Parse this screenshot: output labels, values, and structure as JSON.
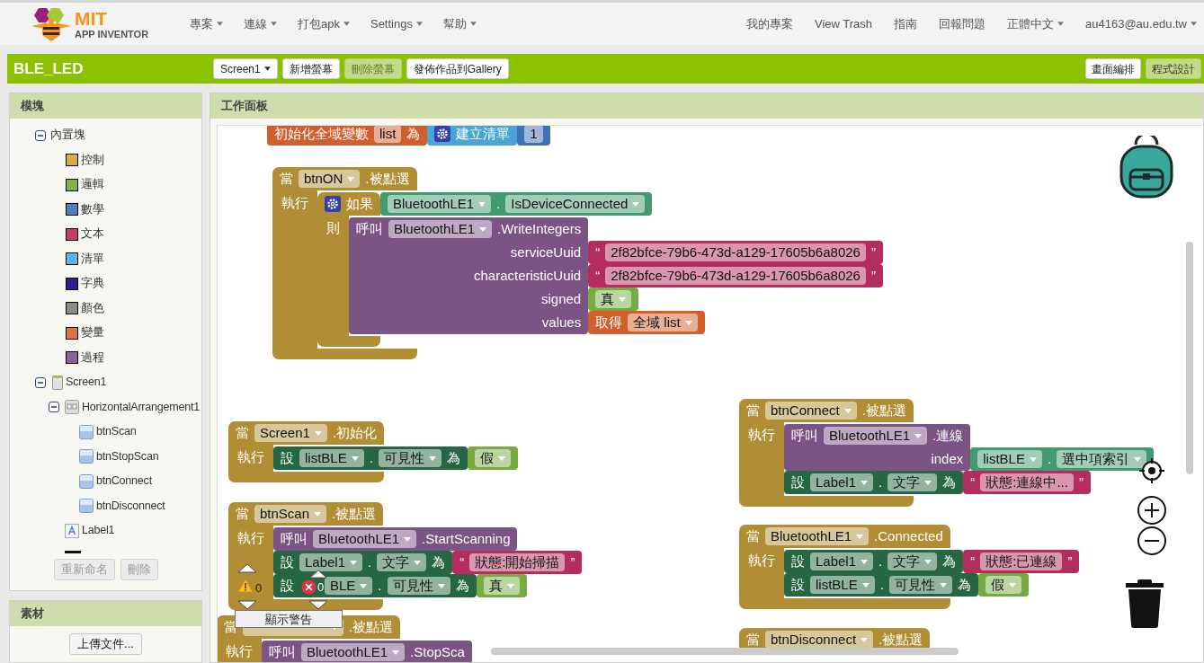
{
  "logo": {
    "title": "MIT",
    "subtitle": "APP INVENTOR"
  },
  "menus": [
    {
      "label": "專案",
      "dropdown": true
    },
    {
      "label": "連線",
      "dropdown": true
    },
    {
      "label": "打包apk",
      "dropdown": true
    },
    {
      "label": "Settings",
      "dropdown": true
    },
    {
      "label": "幫助",
      "dropdown": true
    }
  ],
  "right_menus": [
    {
      "label": "我的專案",
      "dropdown": false
    },
    {
      "label": "View Trash",
      "dropdown": false
    },
    {
      "label": "指南",
      "dropdown": false
    },
    {
      "label": "回報問題",
      "dropdown": false
    },
    {
      "label": "正體中文",
      "dropdown": true
    },
    {
      "label": "au4163@au.edu.tw",
      "dropdown": true
    }
  ],
  "project_bar": {
    "project_name": "BLE_LED",
    "screen_selector": "Screen1",
    "buttons": [
      {
        "label": "新增螢幕",
        "disabled": false
      },
      {
        "label": "刪除螢幕",
        "disabled": true
      },
      {
        "label": "發佈作品到Gallery",
        "disabled": false
      }
    ],
    "view_toggle": [
      {
        "label": "畫面編排",
        "selected": false
      },
      {
        "label": "程式設計",
        "selected": true
      }
    ]
  },
  "blocks_panel": {
    "title": "模塊",
    "tree": [
      {
        "label": "內置塊",
        "kind": "folder",
        "expanded": true,
        "children": [
          {
            "label": "控制",
            "kind": "category",
            "color": "#d5aa47"
          },
          {
            "label": "邏輯",
            "kind": "category",
            "color": "#7fb24b"
          },
          {
            "label": "數學",
            "kind": "category",
            "color": "#4a80c0"
          },
          {
            "label": "文本",
            "kind": "category",
            "color": "#c43f6c"
          },
          {
            "label": "清單",
            "kind": "category",
            "color": "#55b7df"
          },
          {
            "label": "字典",
            "kind": "category",
            "color": "#2a1f8f"
          },
          {
            "label": "顏色",
            "kind": "category",
            "color": "#8a8a8a"
          },
          {
            "label": "變量",
            "kind": "category",
            "color": "#e1733a"
          },
          {
            "label": "過程",
            "kind": "category",
            "color": "#8a6597"
          }
        ]
      },
      {
        "label": "Screen1",
        "kind": "screen",
        "expanded": true,
        "children": [
          {
            "label": "HorizontalArrangement1",
            "kind": "arrangement",
            "expanded": true,
            "children": [
              {
                "label": "btnScan",
                "kind": "button"
              },
              {
                "label": "btnStopScan",
                "kind": "button"
              },
              {
                "label": "btnConnect",
                "kind": "button"
              },
              {
                "label": "btnDisconnect",
                "kind": "button"
              }
            ]
          },
          {
            "label": "Label1",
            "kind": "label"
          },
          {
            "kind": "listview"
          }
        ]
      }
    ],
    "buttons": [
      {
        "label": "重新命名",
        "disabled": true
      },
      {
        "label": "刪除",
        "disabled": true
      }
    ]
  },
  "assets_panel": {
    "title": "素材",
    "button": "上傳文件..."
  },
  "workspace": {
    "title": "工作面板",
    "blocks": [
      {
        "kind": "variable",
        "parts": [
          {
            "kind": "label",
            "text": "初始化全域變數"
          },
          {
            "kind": "field",
            "text": "list"
          },
          {
            "kind": "label",
            "text": "為"
          }
        ],
        "input": {
          "kind": "list",
          "parts": [
            {
              "kind": "gear"
            },
            {
              "kind": "label",
              "text": "建立清單"
            }
          ],
          "input": {
            "kind": "number",
            "parts": [
              {
                "kind": "field",
                "text": "1"
              }
            ]
          }
        }
      },
      {
        "kind": "event",
        "parts": [
          {
            "kind": "label",
            "text": "當"
          },
          {
            "kind": "dropdown",
            "text": "btnON"
          },
          {
            "kind": "label",
            "text": ".被點選"
          }
        ],
        "slots": [
          {
            "label": "執行",
            "body": [
              {
                "kind": "control",
                "parts": [
                  {
                    "kind": "gear"
                  },
                  {
                    "kind": "label",
                    "text": "如果"
                  }
                ],
                "input": {
                  "kind": "getter",
                  "parts": [
                    {
                      "kind": "dropdown",
                      "text": "BluetoothLE1"
                    },
                    {
                      "kind": "label",
                      "text": "."
                    },
                    {
                      "kind": "dropdown",
                      "text": "IsDeviceConnected"
                    }
                  ]
                },
                "slots": [
                  {
                    "label": "則",
                    "body": [
                      {
                        "kind": "call",
                        "parts": [
                          {
                            "kind": "label",
                            "text": "呼叫"
                          },
                          {
                            "kind": "dropdown",
                            "text": "BluetoothLE1"
                          },
                          {
                            "kind": "label",
                            "text": ".WriteIntegers"
                          }
                        ],
                        "args": [
                          {
                            "name": "serviceUuid",
                            "input": {
                              "kind": "text",
                              "parts": [
                                {
                                  "kind": "label",
                                  "text": "“"
                                },
                                {
                                  "kind": "field",
                                  "text": "2f82bfce-79b6-473d-a129-17605b6a8026"
                                },
                                {
                                  "kind": "label",
                                  "text": "”"
                                }
                              ]
                            }
                          },
                          {
                            "name": "characteristicUuid",
                            "input": {
                              "kind": "text",
                              "parts": [
                                {
                                  "kind": "label",
                                  "text": "“"
                                },
                                {
                                  "kind": "field",
                                  "text": "2f82bfce-79b6-473d-a129-17605b6a8026"
                                },
                                {
                                  "kind": "label",
                                  "text": "”"
                                }
                              ]
                            }
                          },
                          {
                            "name": "signed",
                            "input": {
                              "kind": "logic",
                              "parts": [
                                {
                                  "kind": "dropdown",
                                  "text": "真"
                                }
                              ]
                            }
                          },
                          {
                            "name": "values",
                            "input": {
                              "kind": "variable",
                              "parts": [
                                {
                                  "kind": "label",
                                  "text": "取得"
                                },
                                {
                                  "kind": "dropdown",
                                  "text": "全域 list"
                                }
                              ]
                            }
                          }
                        ]
                      }
                    ]
                  }
                ]
              }
            ]
          }
        ]
      },
      {
        "kind": "event",
        "parts": [
          {
            "kind": "label",
            "text": "當"
          },
          {
            "kind": "dropdown",
            "text": "Screen1"
          },
          {
            "kind": "label",
            "text": ".初始化"
          }
        ],
        "slots": [
          {
            "label": "執行",
            "body": [
              {
                "kind": "setter",
                "parts": [
                  {
                    "kind": "label",
                    "text": "設"
                  },
                  {
                    "kind": "dropdown",
                    "text": "listBLE"
                  },
                  {
                    "kind": "label",
                    "text": "."
                  },
                  {
                    "kind": "dropdown",
                    "text": "可見性"
                  },
                  {
                    "kind": "label",
                    "text": "為"
                  }
                ],
                "input": {
                  "kind": "logic",
                  "parts": [
                    {
                      "kind": "dropdown",
                      "text": "假"
                    }
                  ]
                }
              }
            ]
          }
        ]
      },
      {
        "kind": "event",
        "parts": [
          {
            "kind": "label",
            "text": "當"
          },
          {
            "kind": "dropdown",
            "text": "btnScan"
          },
          {
            "kind": "label",
            "text": ".被點選"
          }
        ],
        "slots": [
          {
            "label": "執行",
            "body": [
              {
                "kind": "call",
                "parts": [
                  {
                    "kind": "label",
                    "text": "呼叫"
                  },
                  {
                    "kind": "dropdown",
                    "text": "BluetoothLE1"
                  },
                  {
                    "kind": "label",
                    "text": ".StartScanning"
                  }
                ]
              },
              {
                "kind": "setter",
                "parts": [
                  {
                    "kind": "label",
                    "text": "設"
                  },
                  {
                    "kind": "dropdown",
                    "text": "Label1"
                  },
                  {
                    "kind": "label",
                    "text": "."
                  },
                  {
                    "kind": "dropdown",
                    "text": "文字"
                  },
                  {
                    "kind": "label",
                    "text": "為"
                  }
                ],
                "input": {
                  "kind": "text",
                  "parts": [
                    {
                      "kind": "label",
                      "text": "“"
                    },
                    {
                      "kind": "field",
                      "text": "狀態:開始掃描"
                    },
                    {
                      "kind": "label",
                      "text": "”"
                    }
                  ]
                }
              },
              {
                "kind": "setter",
                "parts": [
                  {
                    "kind": "label",
                    "text": "設"
                  },
                  {
                    "kind": "dropdown",
                    "text": "BLE"
                  },
                  {
                    "kind": "label",
                    "text": "."
                  },
                  {
                    "kind": "dropdown",
                    "text": "可見性"
                  },
                  {
                    "kind": "label",
                    "text": "為"
                  }
                ],
                "input": {
                  "kind": "logic",
                  "parts": [
                    {
                      "kind": "dropdown",
                      "text": "真"
                    }
                  ]
                }
              }
            ]
          }
        ]
      },
      {
        "kind": "event",
        "parts": [
          {
            "kind": "label",
            "text": "當"
          },
          {
            "kind": "dropdown"
          },
          {
            "kind": "label",
            "text": ".被點選"
          }
        ],
        "slots": [
          {
            "label": "執行",
            "body": [
              {
                "kind": "call",
                "parts": [
                  {
                    "kind": "label",
                    "text": "呼叫"
                  },
                  {
                    "kind": "dropdown",
                    "text": "BluetoothLE1"
                  },
                  {
                    "kind": "label",
                    "text": ".StopSca"
                  }
                ]
              }
            ]
          }
        ]
      },
      {
        "kind": "event",
        "parts": [
          {
            "kind": "label",
            "text": "當"
          },
          {
            "kind": "dropdown",
            "text": "btnConnect"
          },
          {
            "kind": "label",
            "text": ".被點選"
          }
        ],
        "slots": [
          {
            "label": "執行",
            "body": [
              {
                "kind": "call",
                "parts": [
                  {
                    "kind": "label",
                    "text": "呼叫"
                  },
                  {
                    "kind": "dropdown",
                    "text": "BluetoothLE1"
                  },
                  {
                    "kind": "label",
                    "text": ".連線"
                  }
                ],
                "args": [
                  {
                    "name": "index",
                    "input": {
                      "kind": "getter",
                      "parts": [
                        {
                          "kind": "dropdown",
                          "text": "listBLE"
                        },
                        {
                          "kind": "label",
                          "text": "."
                        },
                        {
                          "kind": "dropdown",
                          "text": "選中項索引"
                        }
                      ]
                    }
                  }
                ]
              },
              {
                "kind": "setter",
                "parts": [
                  {
                    "kind": "label",
                    "text": "設"
                  },
                  {
                    "kind": "dropdown",
                    "text": "Label1"
                  },
                  {
                    "kind": "label",
                    "text": "."
                  },
                  {
                    "kind": "dropdown",
                    "text": "文字"
                  },
                  {
                    "kind": "label",
                    "text": "為"
                  }
                ],
                "input": {
                  "kind": "text",
                  "parts": [
                    {
                      "kind": "label",
                      "text": "“"
                    },
                    {
                      "kind": "field",
                      "text": "狀態:連線中..."
                    },
                    {
                      "kind": "label",
                      "text": "”"
                    }
                  ]
                }
              }
            ]
          }
        ]
      },
      {
        "kind": "event",
        "parts": [
          {
            "kind": "label",
            "text": "當"
          },
          {
            "kind": "dropdown",
            "text": "BluetoothLE1"
          },
          {
            "kind": "label",
            "text": ".Connected"
          }
        ],
        "slots": [
          {
            "label": "執行",
            "body": [
              {
                "kind": "setter",
                "parts": [
                  {
                    "kind": "label",
                    "text": "設"
                  },
                  {
                    "kind": "dropdown",
                    "text": "Label1"
                  },
                  {
                    "kind": "label",
                    "text": "."
                  },
                  {
                    "kind": "dropdown",
                    "text": "文字"
                  },
                  {
                    "kind": "label",
                    "text": "為"
                  }
                ],
                "input": {
                  "kind": "text",
                  "parts": [
                    {
                      "kind": "label",
                      "text": "“"
                    },
                    {
                      "kind": "field",
                      "text": "狀態:已連線"
                    },
                    {
                      "kind": "label",
                      "text": "”"
                    }
                  ]
                }
              },
              {
                "kind": "setter",
                "parts": [
                  {
                    "kind": "label",
                    "text": "設"
                  },
                  {
                    "kind": "dropdown",
                    "text": "listBLE"
                  },
                  {
                    "kind": "label",
                    "text": "."
                  },
                  {
                    "kind": "dropdown",
                    "text": "可見性"
                  },
                  {
                    "kind": "label",
                    "text": "為"
                  }
                ],
                "input": {
                  "kind": "logic",
                  "parts": [
                    {
                      "kind": "dropdown",
                      "text": "假"
                    }
                  ]
                }
              }
            ]
          }
        ]
      },
      {
        "kind": "event",
        "parts": [
          {
            "kind": "label",
            "text": "當"
          },
          {
            "kind": "dropdown",
            "text": "btnDisconnect"
          },
          {
            "kind": "label",
            "text": ".被點選"
          }
        ]
      }
    ],
    "warnings": {
      "warning_count": "0",
      "error_count": "0",
      "toggle_label": "顯示警告"
    }
  }
}
